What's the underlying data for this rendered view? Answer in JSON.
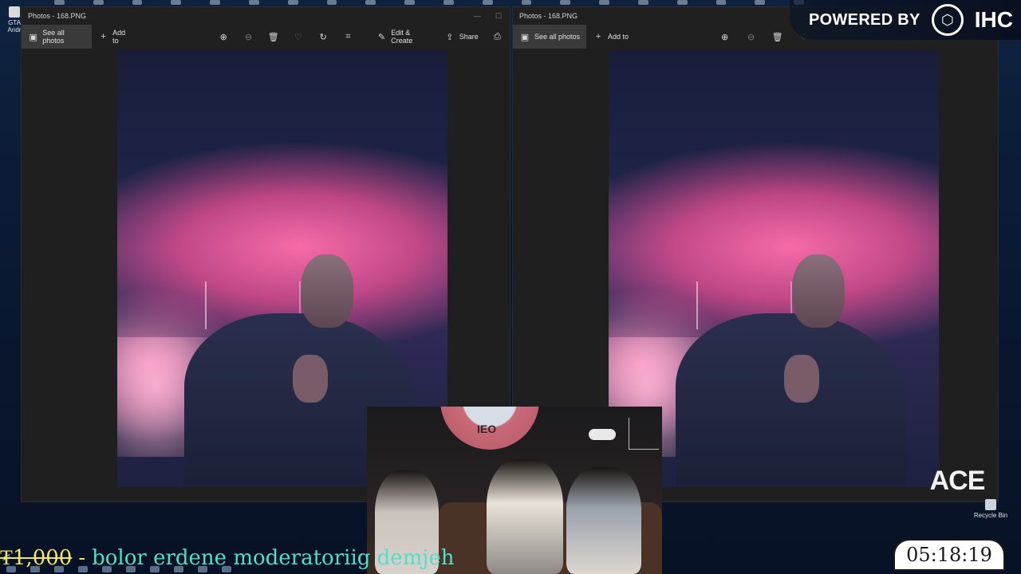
{
  "desktop": {
    "top_left_icon_label": "GTA\nAndr",
    "recycle_bin_label": "Recycle Bin"
  },
  "windows": [
    {
      "title": "Photos - 168.PNG",
      "toolbar": {
        "see_all_photos": "See all photos",
        "add_to": "Add to",
        "edit_create": "Edit & Create",
        "share": "Share"
      }
    },
    {
      "title": "Photos - 168.PNG",
      "toolbar": {
        "see_all_photos": "See all photos",
        "add_to": "Add to"
      }
    }
  ],
  "icons": {
    "photos": "photos-icon",
    "add": "plus-icon",
    "zoom_in": "zoom-in-icon",
    "zoom_out": "zoom-out-icon",
    "delete": "trash-icon",
    "favorite": "heart-icon",
    "rotate": "rotate-icon",
    "crop": "crop-icon",
    "edit": "edit-create-icon",
    "share": "share-icon",
    "print": "print-icon"
  },
  "overlay": {
    "powered_by": "POWERED BY",
    "brand": "IHC",
    "ace_logo": "ACE",
    "webcam_wheel_text": "OƎI",
    "ticker_amount": "₮1,000",
    "ticker_separator": "-",
    "ticker_message": "bolor erdene moderatoriig demjeh",
    "timer": "05:18:19"
  },
  "colors": {
    "ticker_amount": "#f1e46a",
    "ticker_message": "#4fe0c7",
    "photo_pink": "#f0609a",
    "window_bg": "#1f1f1f"
  }
}
